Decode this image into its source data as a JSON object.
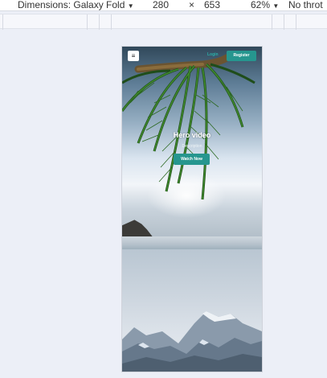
{
  "devtools": {
    "dimensions_label": "Dimensions: Galaxy Fold",
    "width": "280",
    "times": "×",
    "height": "653",
    "zoom": "62%",
    "throttle_label": "No throt"
  },
  "nav": {
    "menu_icon": "≡",
    "login_label": "Login",
    "register_label": "Register"
  },
  "hero": {
    "title": "Hero video",
    "subtitle": "Description",
    "cta_label": "Watch Now"
  },
  "colors": {
    "accent": "#26968f",
    "login_text": "#2ab0a8",
    "page_background": "#eceff7"
  }
}
